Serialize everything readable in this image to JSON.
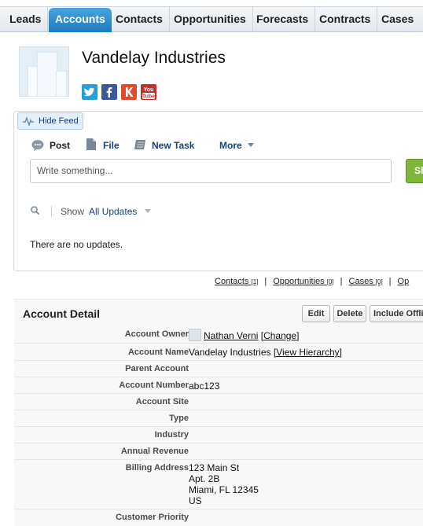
{
  "tabs": [
    "Leads",
    "Accounts",
    "Contacts",
    "Opportunities",
    "Forecasts",
    "Contracts",
    "Cases"
  ],
  "active_tab": "Accounts",
  "account": {
    "name": "Vandelay Industries"
  },
  "social": [
    {
      "name": "twitter-icon",
      "glyph": "t",
      "color": "#2a9fd6"
    },
    {
      "name": "facebook-icon",
      "glyph": "f",
      "color": "#3b5998"
    },
    {
      "name": "klout-icon",
      "glyph": "K",
      "color": "#e44a2a"
    },
    {
      "name": "youtube-icon",
      "glyph": "You Tube",
      "color": "#c4302b"
    }
  ],
  "feed": {
    "hide_label": "Hide Feed",
    "post": "Post",
    "file": "File",
    "new_task": "New Task",
    "more": "More",
    "placeholder": "Write something...",
    "share": "Sh",
    "show_label": "Show",
    "filter_value": "All Updates",
    "empty": "There are no updates."
  },
  "related": [
    {
      "label": "Contacts",
      "count": "[1]"
    },
    {
      "label": "Opportunities",
      "count": "[0]"
    },
    {
      "label": "Cases",
      "count": "[0]"
    },
    {
      "label": "Op",
      "count": ""
    }
  ],
  "detail": {
    "title": "Account Detail",
    "buttons": [
      "Edit",
      "Delete",
      "Include Offli"
    ],
    "fields": {
      "owner_label": "Account Owner",
      "owner_name": "Nathan Verni",
      "owner_change": "[Change]",
      "name_label": "Account Name",
      "name_value": "Vandelay Industries",
      "name_link": "[View Hierarchy]",
      "parent_label": "Parent Account",
      "number_label": "Account Number",
      "number_value": "abc123",
      "site_label": "Account Site",
      "type_label": "Type",
      "industry_label": "Industry",
      "revenue_label": "Annual Revenue",
      "billing_label": "Billing Address",
      "billing_lines": [
        "123 Main St",
        "Apt. 2B",
        "Miami, FL 12345",
        "US"
      ],
      "priority_label": "Customer Priority"
    }
  }
}
